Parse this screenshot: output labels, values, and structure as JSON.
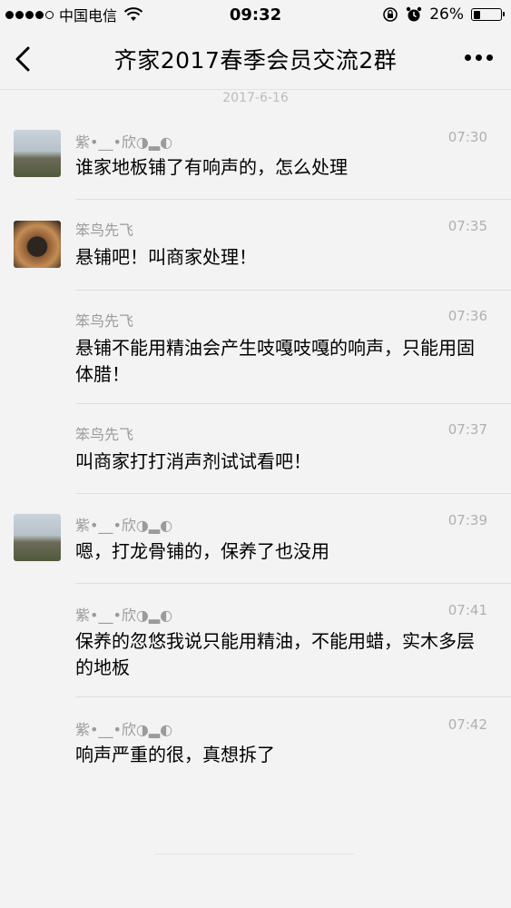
{
  "status_bar": {
    "carrier": "中国电信",
    "time": "09:32",
    "battery_percent": "26%",
    "battery_level": 0.26
  },
  "nav": {
    "title": "齐家2017春季会员交流2群"
  },
  "date_separator": "2017-6-16",
  "messages": [
    {
      "sender": "紫•__•欣◑▂◐",
      "time": "07:30",
      "text": "谁家地板铺了有响声的，怎么处理"
    },
    {
      "sender": "笨鸟先飞",
      "time": "07:35",
      "text": "悬铺吧！叫商家处理！"
    },
    {
      "sender": "笨鸟先飞",
      "time": "07:36",
      "text": "悬铺不能用精油会产生吱嘎吱嘎的响声，只能用固体腊！"
    },
    {
      "sender": "笨鸟先飞",
      "time": "07:37",
      "text": "叫商家打打消声剂试试看吧！"
    },
    {
      "sender": "紫•__•欣◑▂◐",
      "time": "07:39",
      "text": "嗯，打龙骨铺的，保养了也没用"
    },
    {
      "sender": "紫•__•欣◑▂◐",
      "time": "07:41",
      "text": "保养的忽悠我说只能用精油，不能用蜡，实木多层的地板"
    },
    {
      "sender": "紫•__•欣◑▂◐",
      "time": "07:42",
      "text": "响声严重的很，真想拆了"
    }
  ]
}
